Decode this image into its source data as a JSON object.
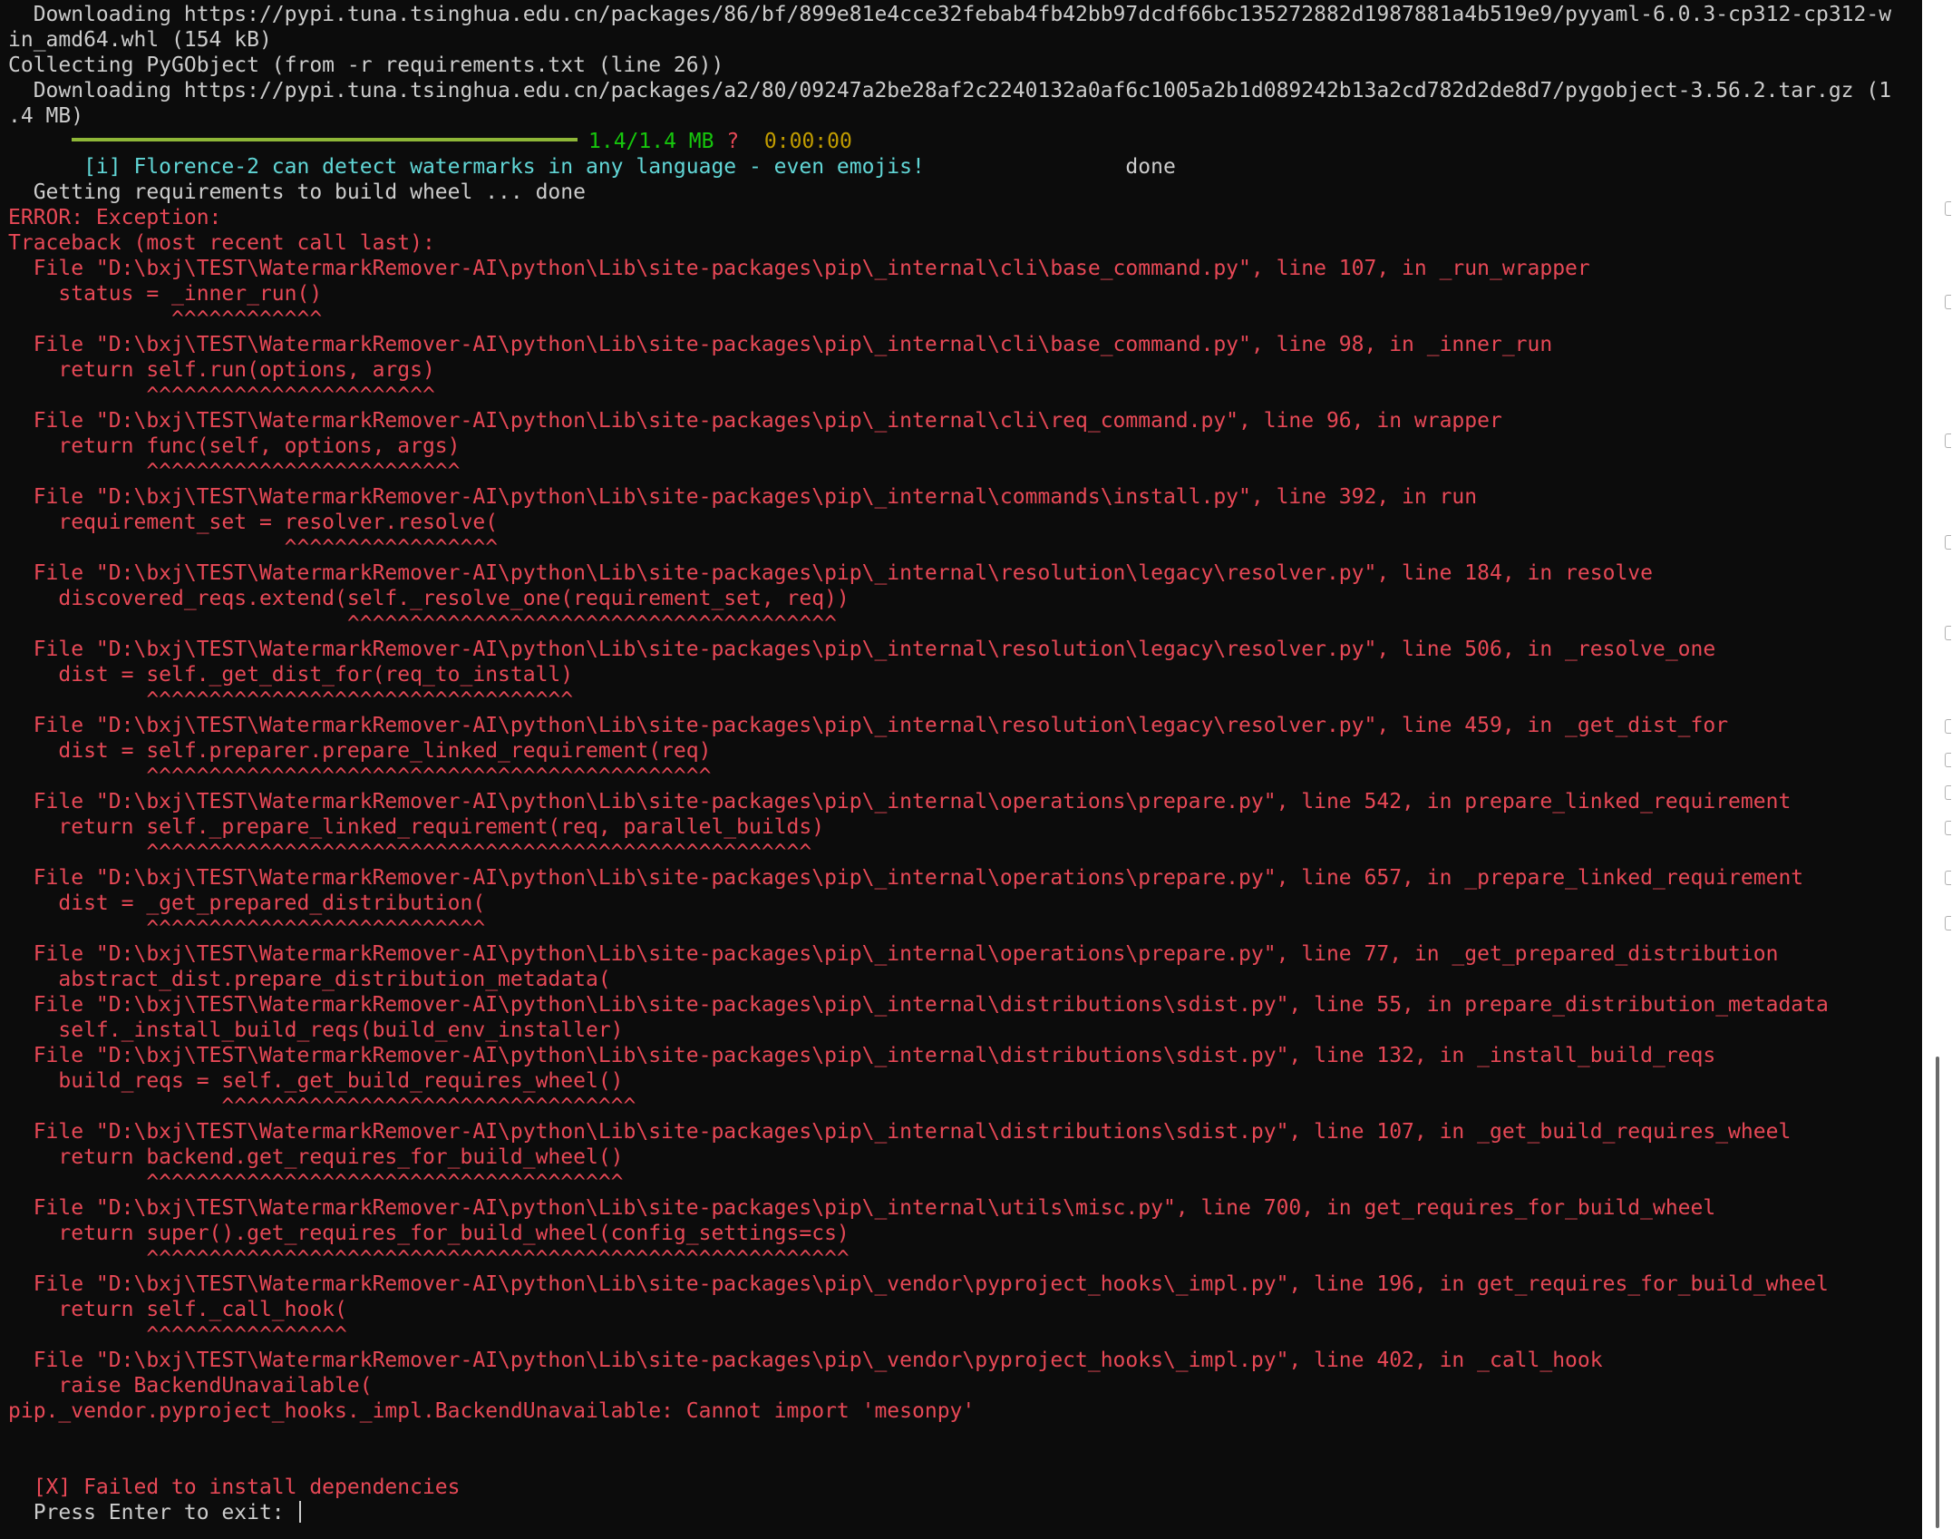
{
  "terminal": {
    "lines": [
      {
        "color": "normal",
        "text": "  Downloading https://pypi.tuna.tsinghua.edu.cn/packages/86/bf/899e81e4cce32febab4fb42bb97dcdf66bc135272882d1987881a4b519e9/pyyaml-6.0.3-cp312-cp312-w"
      },
      {
        "color": "normal",
        "text": "in_amd64.whl (154 kB)"
      },
      {
        "color": "normal",
        "text": "Collecting PyGObject (from -r requirements.txt (line 26))"
      },
      {
        "color": "normal",
        "text": "  Downloading https://pypi.tuna.tsinghua.edu.cn/packages/a2/80/09247a2be28af2c2240132a0af6c1005a2b1d089242b13a2cd782d2de8d7/pygobject-3.56.2.tar.gz (1"
      },
      {
        "color": "normal",
        "text": ".4 MB)"
      },
      {
        "type": "progress"
      },
      {
        "type": "info"
      },
      {
        "color": "normal",
        "text": "  Getting requirements to build wheel ... done"
      },
      {
        "color": "red",
        "text": "ERROR: Exception:"
      },
      {
        "color": "red",
        "text": "Traceback (most recent call last):"
      },
      {
        "color": "red",
        "text": "  File \"D:\\bxj\\TEST\\WatermarkRemover-AI\\python\\Lib\\site-packages\\pip\\_internal\\cli\\base_command.py\", line 107, in _run_wrapper"
      },
      {
        "color": "red",
        "text": "    status = _inner_run()"
      },
      {
        "color": "red",
        "text": "             ^^^^^^^^^^^^"
      },
      {
        "color": "red",
        "text": "  File \"D:\\bxj\\TEST\\WatermarkRemover-AI\\python\\Lib\\site-packages\\pip\\_internal\\cli\\base_command.py\", line 98, in _inner_run"
      },
      {
        "color": "red",
        "text": "    return self.run(options, args)"
      },
      {
        "color": "red",
        "text": "           ^^^^^^^^^^^^^^^^^^^^^^^"
      },
      {
        "color": "red",
        "text": "  File \"D:\\bxj\\TEST\\WatermarkRemover-AI\\python\\Lib\\site-packages\\pip\\_internal\\cli\\req_command.py\", line 96, in wrapper"
      },
      {
        "color": "red",
        "text": "    return func(self, options, args)"
      },
      {
        "color": "red",
        "text": "           ^^^^^^^^^^^^^^^^^^^^^^^^^"
      },
      {
        "color": "red",
        "text": "  File \"D:\\bxj\\TEST\\WatermarkRemover-AI\\python\\Lib\\site-packages\\pip\\_internal\\commands\\install.py\", line 392, in run"
      },
      {
        "color": "red",
        "text": "    requirement_set = resolver.resolve("
      },
      {
        "color": "red",
        "text": "                      ^^^^^^^^^^^^^^^^^"
      },
      {
        "color": "red",
        "text": "  File \"D:\\bxj\\TEST\\WatermarkRemover-AI\\python\\Lib\\site-packages\\pip\\_internal\\resolution\\legacy\\resolver.py\", line 184, in resolve"
      },
      {
        "color": "red",
        "text": "    discovered_reqs.extend(self._resolve_one(requirement_set, req))"
      },
      {
        "color": "red",
        "text": "                           ^^^^^^^^^^^^^^^^^^^^^^^^^^^^^^^^^^^^^^^"
      },
      {
        "color": "red",
        "text": "  File \"D:\\bxj\\TEST\\WatermarkRemover-AI\\python\\Lib\\site-packages\\pip\\_internal\\resolution\\legacy\\resolver.py\", line 506, in _resolve_one"
      },
      {
        "color": "red",
        "text": "    dist = self._get_dist_for(req_to_install)"
      },
      {
        "color": "red",
        "text": "           ^^^^^^^^^^^^^^^^^^^^^^^^^^^^^^^^^^"
      },
      {
        "color": "red",
        "text": "  File \"D:\\bxj\\TEST\\WatermarkRemover-AI\\python\\Lib\\site-packages\\pip\\_internal\\resolution\\legacy\\resolver.py\", line 459, in _get_dist_for"
      },
      {
        "color": "red",
        "text": "    dist = self.preparer.prepare_linked_requirement(req)"
      },
      {
        "color": "red",
        "text": "           ^^^^^^^^^^^^^^^^^^^^^^^^^^^^^^^^^^^^^^^^^^^^^"
      },
      {
        "color": "red",
        "text": "  File \"D:\\bxj\\TEST\\WatermarkRemover-AI\\python\\Lib\\site-packages\\pip\\_internal\\operations\\prepare.py\", line 542, in prepare_linked_requirement"
      },
      {
        "color": "red",
        "text": "    return self._prepare_linked_requirement(req, parallel_builds)"
      },
      {
        "color": "red",
        "text": "           ^^^^^^^^^^^^^^^^^^^^^^^^^^^^^^^^^^^^^^^^^^^^^^^^^^^^^"
      },
      {
        "color": "red",
        "text": "  File \"D:\\bxj\\TEST\\WatermarkRemover-AI\\python\\Lib\\site-packages\\pip\\_internal\\operations\\prepare.py\", line 657, in _prepare_linked_requirement"
      },
      {
        "color": "red",
        "text": "    dist = _get_prepared_distribution("
      },
      {
        "color": "red",
        "text": "           ^^^^^^^^^^^^^^^^^^^^^^^^^^^"
      },
      {
        "color": "red",
        "text": "  File \"D:\\bxj\\TEST\\WatermarkRemover-AI\\python\\Lib\\site-packages\\pip\\_internal\\operations\\prepare.py\", line 77, in _get_prepared_distribution"
      },
      {
        "color": "red",
        "text": "    abstract_dist.prepare_distribution_metadata("
      },
      {
        "color": "red",
        "text": "  File \"D:\\bxj\\TEST\\WatermarkRemover-AI\\python\\Lib\\site-packages\\pip\\_internal\\distributions\\sdist.py\", line 55, in prepare_distribution_metadata"
      },
      {
        "color": "red",
        "text": "    self._install_build_reqs(build_env_installer)"
      },
      {
        "color": "red",
        "text": "  File \"D:\\bxj\\TEST\\WatermarkRemover-AI\\python\\Lib\\site-packages\\pip\\_internal\\distributions\\sdist.py\", line 132, in _install_build_reqs"
      },
      {
        "color": "red",
        "text": "    build_reqs = self._get_build_requires_wheel()"
      },
      {
        "color": "red",
        "text": "                 ^^^^^^^^^^^^^^^^^^^^^^^^^^^^^^^^^"
      },
      {
        "color": "red",
        "text": "  File \"D:\\bxj\\TEST\\WatermarkRemover-AI\\python\\Lib\\site-packages\\pip\\_internal\\distributions\\sdist.py\", line 107, in _get_build_requires_wheel"
      },
      {
        "color": "red",
        "text": "    return backend.get_requires_for_build_wheel()"
      },
      {
        "color": "red",
        "text": "           ^^^^^^^^^^^^^^^^^^^^^^^^^^^^^^^^^^^^^^"
      },
      {
        "color": "red",
        "text": "  File \"D:\\bxj\\TEST\\WatermarkRemover-AI\\python\\Lib\\site-packages\\pip\\_internal\\utils\\misc.py\", line 700, in get_requires_for_build_wheel"
      },
      {
        "color": "red",
        "text": "    return super().get_requires_for_build_wheel(config_settings=cs)"
      },
      {
        "color": "red",
        "text": "           ^^^^^^^^^^^^^^^^^^^^^^^^^^^^^^^^^^^^^^^^^^^^^^^^^^^^^^^^"
      },
      {
        "color": "red",
        "text": "  File \"D:\\bxj\\TEST\\WatermarkRemover-AI\\python\\Lib\\site-packages\\pip\\_vendor\\pyproject_hooks\\_impl.py\", line 196, in get_requires_for_build_wheel"
      },
      {
        "color": "red",
        "text": "    return self._call_hook("
      },
      {
        "color": "red",
        "text": "           ^^^^^^^^^^^^^^^^"
      },
      {
        "color": "red",
        "text": "  File \"D:\\bxj\\TEST\\WatermarkRemover-AI\\python\\Lib\\site-packages\\pip\\_vendor\\pyproject_hooks\\_impl.py\", line 402, in _call_hook"
      },
      {
        "color": "red",
        "text": "    raise BackendUnavailable("
      },
      {
        "color": "red",
        "text": "pip._vendor.pyproject_hooks._impl.BackendUnavailable: Cannot import 'mesonpy'"
      },
      {
        "color": "normal",
        "text": ""
      },
      {
        "color": "normal",
        "text": ""
      },
      {
        "color": "red",
        "text": "  [X] Failed to install dependencies"
      },
      {
        "type": "prompt"
      }
    ],
    "progress": {
      "size_text": "1.4/1.4 MB",
      "eta_marker": "?",
      "time_text": "0:00:00",
      "fraction": 1.0
    },
    "info": {
      "text": "      [i] Florence-2 can detect watermarks in any language - even emojis!",
      "done_text": "done"
    },
    "prompt": {
      "text": "  Press Enter to exit: "
    },
    "colors": {
      "background": "#0c0c0c",
      "normal": "#cccccc",
      "red": "#e74856",
      "cyan": "#61d6d6",
      "green": "#16c60c",
      "gold": "#c19c00",
      "progress_bar": "#8fb738"
    }
  }
}
